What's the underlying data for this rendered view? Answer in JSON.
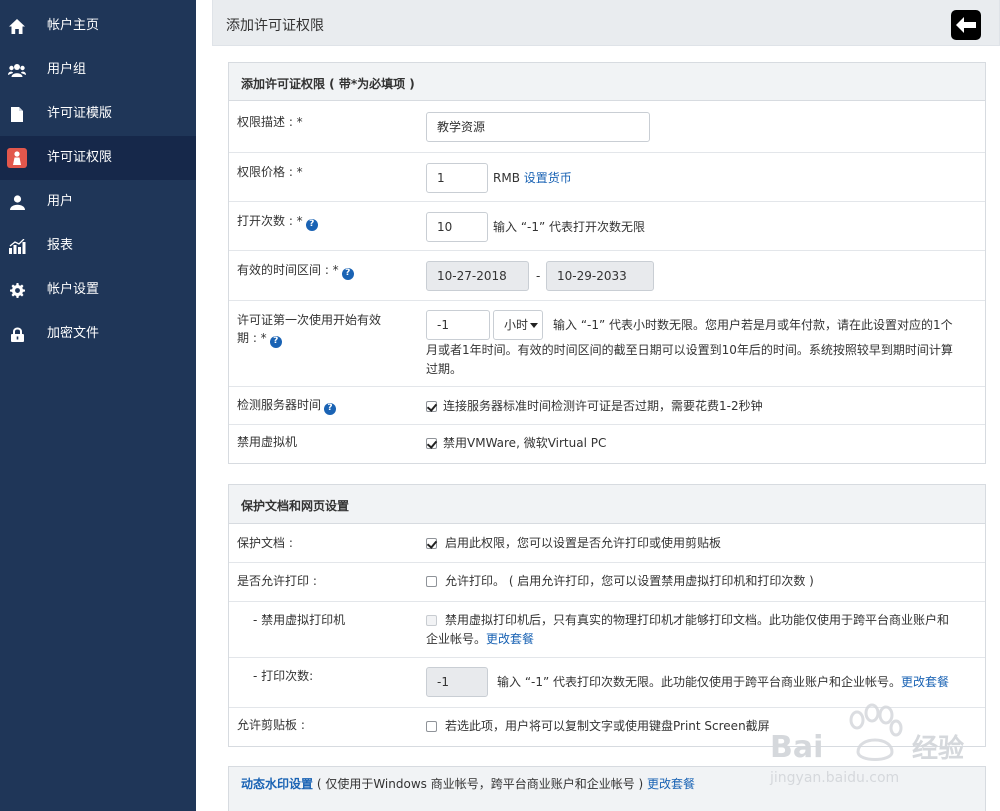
{
  "sidebar": {
    "items": [
      {
        "label": "帐户主页",
        "icon": "home-icon"
      },
      {
        "label": "用户组",
        "icon": "user-group-icon"
      },
      {
        "label": "许可证模版",
        "icon": "document-icon"
      },
      {
        "label": "许可证权限",
        "icon": "license-icon",
        "active": true
      },
      {
        "label": "用户",
        "icon": "user-icon"
      },
      {
        "label": "报表",
        "icon": "report-icon"
      },
      {
        "label": "帐户设置",
        "icon": "gear-icon"
      },
      {
        "label": "加密文件",
        "icon": "lock-icon"
      }
    ]
  },
  "header": {
    "title": "添加许可证权限",
    "back_icon": "back-arrow-icon"
  },
  "section1": {
    "title": "添加许可证权限 ( 带*为必填项 )",
    "description": {
      "label": "权限描述 : *",
      "value": "教学资源"
    },
    "price": {
      "label": "权限价格 : *",
      "value": "1",
      "unit": "RMB",
      "link": "设置货币"
    },
    "open_count": {
      "label": "打开次数 : *",
      "value": "10",
      "hint": "输入 “-1” 代表打开次数无限"
    },
    "valid_range": {
      "label": "有效的时间区间 : *",
      "start": "10-27-2018",
      "sep": "-",
      "end": "10-29-2033"
    },
    "first_use": {
      "label_line1": "许可证第一次使用开始有效",
      "label_line2": "期 : *",
      "value": "-1",
      "unit": "小时",
      "hint_line1": "输入 “-1” 代表小时数无限。您用户若是月或年付款，请在此设置对应的1个",
      "hint_line2": "月或者1年时间。有效的时间区间的截至日期可以设置到10年后的时间。系统按照较早到期时间计算",
      "hint_line3": "过期。"
    },
    "server_time": {
      "label": "检测服务器时间",
      "text": "连接服务器标准时间检测许可证是否过期，需要花费1-2秒钟",
      "checked": true
    },
    "vm": {
      "label": "禁用虚拟机",
      "text": "禁用VMWare, 微软Virtual PC",
      "checked": true
    }
  },
  "section2": {
    "title": "保护文档和网页设置",
    "protect": {
      "label": "保护文档 :",
      "text": "启用此权限，您可以设置是否允许打印或使用剪贴板",
      "checked": true
    },
    "allow_print": {
      "label": "是否允许打印 :",
      "text": "允许打印。 ( 启用允许打印，您可以设置禁用虚拟打印机和打印次数 )",
      "checked": false
    },
    "virtual_printer": {
      "label": "- 禁用虚拟打印机",
      "text_line1": "禁用虚拟打印机后，只有真实的物理打印机才能够打印文档。此功能仅使用于跨平台商业账户和",
      "text_line2": "企业帐号。",
      "link": "更改套餐",
      "checked": false
    },
    "print_count": {
      "label": "- 打印次数:",
      "value": "-1",
      "hint": "输入 “-1” 代表打印次数无限。此功能仅使用于跨平台商业账户和企业帐号。",
      "link": "更改套餐"
    },
    "clipboard": {
      "label": "允许剪贴板 :",
      "text": "若选此项，用户将可以复制文字或使用键盘Print Screen截屏",
      "checked": false
    }
  },
  "section3": {
    "title": "动态水印设置",
    "note": " ( 仅使用于Windows 商业帐号，跨平台商业账户和企业帐号 ) ",
    "link": "更改套餐"
  },
  "watermark": {
    "text1": "Bai",
    "text2": "经验",
    "url": "jingyan.baidu.com"
  },
  "colors": {
    "sidebar": "#1f3658",
    "sidebar_active": "#16284a",
    "link": "#1a63b4",
    "help": "#1a63b4",
    "license_icon": "#e2574c"
  }
}
